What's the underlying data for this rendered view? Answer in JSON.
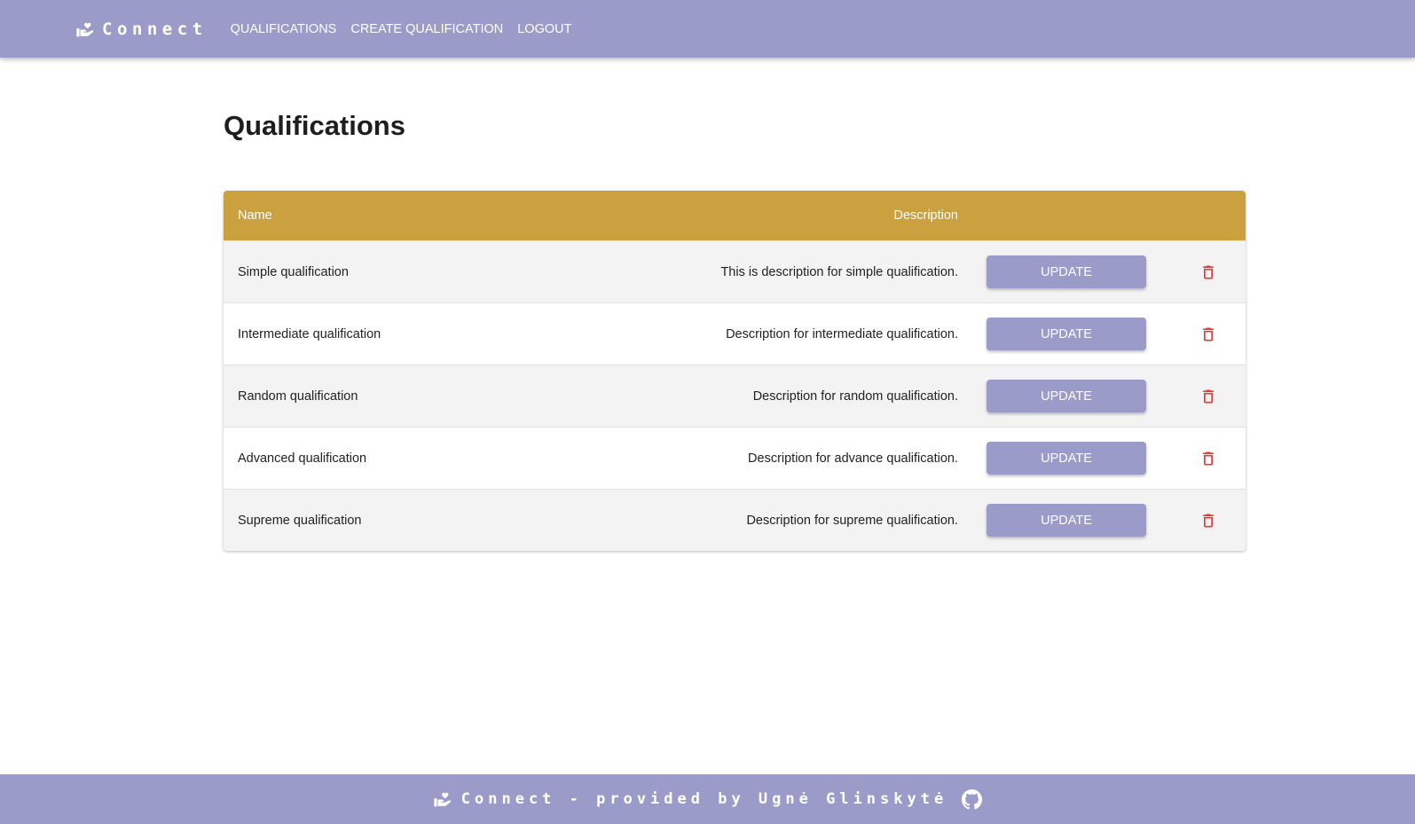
{
  "app": {
    "brand": "Connect",
    "logo_icon": "hand-heart-icon"
  },
  "nav": {
    "items": [
      "QUALIFICATIONS",
      "CREATE QUALIFICATION",
      "LOGOUT"
    ]
  },
  "page": {
    "title": "Qualifications"
  },
  "table": {
    "headers": {
      "name": "Name",
      "description": "Description"
    },
    "rows": [
      {
        "name": "Simple qualification",
        "description": "This is description for simple qualification.",
        "action": "UPDATE"
      },
      {
        "name": "Intermediate qualification",
        "description": "Description for intermediate qualification.",
        "action": "UPDATE"
      },
      {
        "name": "Random qualification",
        "description": "Description for random qualification.",
        "action": "UPDATE"
      },
      {
        "name": "Advanced qualification",
        "description": "Description for advance qualification.",
        "action": "UPDATE"
      },
      {
        "name": "Supreme qualification",
        "description": "Description for supreme qualification.",
        "action": "UPDATE"
      }
    ]
  },
  "footer": {
    "text": "Connect - provided by Ugnė Glinskytė",
    "link_icon": "github-icon"
  },
  "colors": {
    "primary": "#9b9bca",
    "table_header": "#cba03f",
    "delete": "#e53935",
    "row_alt": "#f3f3f3"
  }
}
